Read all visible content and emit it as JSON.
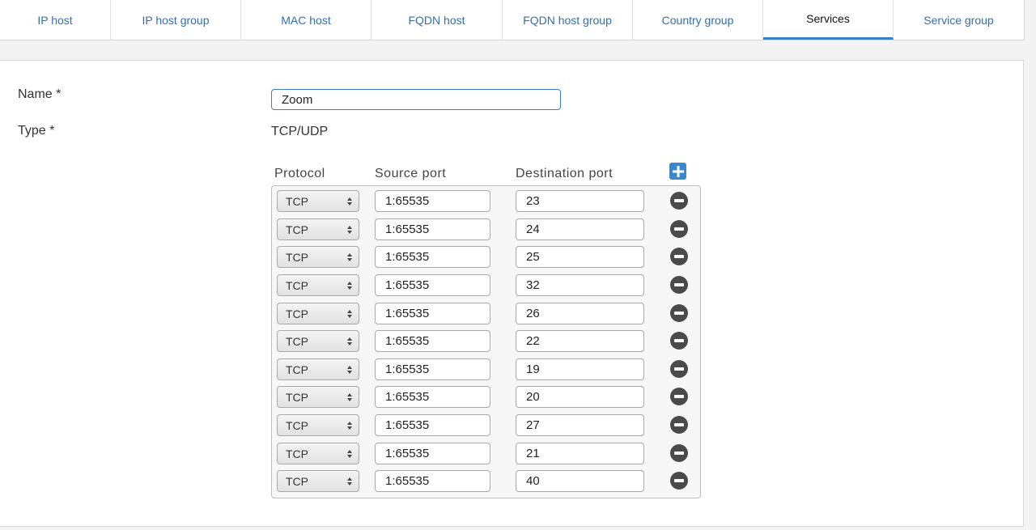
{
  "tabs": [
    {
      "label": "IP host"
    },
    {
      "label": "IP host group"
    },
    {
      "label": "MAC host"
    },
    {
      "label": "FQDN host"
    },
    {
      "label": "FQDN host group"
    },
    {
      "label": "Country group"
    },
    {
      "label": "Services",
      "active": true
    },
    {
      "label": "Service group"
    }
  ],
  "form": {
    "name_label": "Name *",
    "name_value": "Zoom",
    "type_label": "Type *",
    "type_value": "TCP/UDP"
  },
  "table": {
    "headers": {
      "protocol": "Protocol",
      "source": "Source port",
      "destination": "Destination port"
    },
    "rows": [
      {
        "protocol": "TCP",
        "source": "1:65535",
        "destination": "23"
      },
      {
        "protocol": "TCP",
        "source": "1:65535",
        "destination": "24"
      },
      {
        "protocol": "TCP",
        "source": "1:65535",
        "destination": "25"
      },
      {
        "protocol": "TCP",
        "source": "1:65535",
        "destination": "32"
      },
      {
        "protocol": "TCP",
        "source": "1:65535",
        "destination": "26"
      },
      {
        "protocol": "TCP",
        "source": "1:65535",
        "destination": "22"
      },
      {
        "protocol": "TCP",
        "source": "1:65535",
        "destination": "19"
      },
      {
        "protocol": "TCP",
        "source": "1:65535",
        "destination": "20"
      },
      {
        "protocol": "TCP",
        "source": "1:65535",
        "destination": "27"
      },
      {
        "protocol": "TCP",
        "source": "1:65535",
        "destination": "21"
      },
      {
        "protocol": "TCP",
        "source": "1:65535",
        "destination": "40"
      }
    ]
  },
  "icons": {
    "add": "plus-icon",
    "remove": "minus-circle-icon",
    "select": "select-arrows-icon"
  },
  "colors": {
    "accent": "#3a7fc9",
    "link": "#2f6fb5",
    "remove": "#4a4a4a"
  }
}
